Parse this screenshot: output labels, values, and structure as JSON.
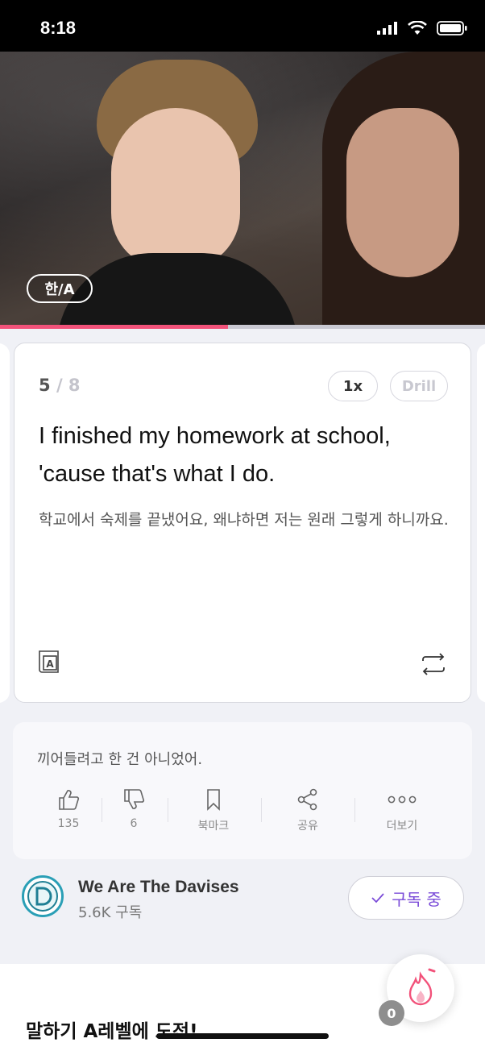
{
  "status_bar": {
    "time": "8:18"
  },
  "video": {
    "lang_toggle": "한/A",
    "progress": 0.47,
    "progress_color": "#f2527a"
  },
  "card": {
    "current": "5",
    "total": "/ 8",
    "speed": "1x",
    "drill": "Drill",
    "sentence_line1": "I finished my homework at school,",
    "sentence_line2": "'cause that's what I do.",
    "translation": "학교에서 숙제를 끝냈어요, 왜냐하면 저는 원래 그렇게 하니까요.",
    "left_icon": "dictionary-icon",
    "right_icon": "repeat-icon"
  },
  "comment": {
    "text": "끼어들려고 한 건 아니었어.",
    "actions": [
      {
        "icon": "thumbs-up-icon",
        "label": "135"
      },
      {
        "icon": "thumbs-down-icon",
        "label": "6"
      },
      {
        "icon": "bookmark-icon",
        "label": "북마크"
      },
      {
        "icon": "share-icon",
        "label": "공유"
      },
      {
        "icon": "more-icon",
        "label": "더보기"
      }
    ]
  },
  "channel": {
    "name": "We Are The Davises",
    "subscribers": "5.6K 구독",
    "subscribe_label": "구독 중",
    "accent": "#7a4bd8"
  },
  "bottom": {
    "challenge_title": "말하기 A레벨에 도전!",
    "fire_count": "0"
  }
}
